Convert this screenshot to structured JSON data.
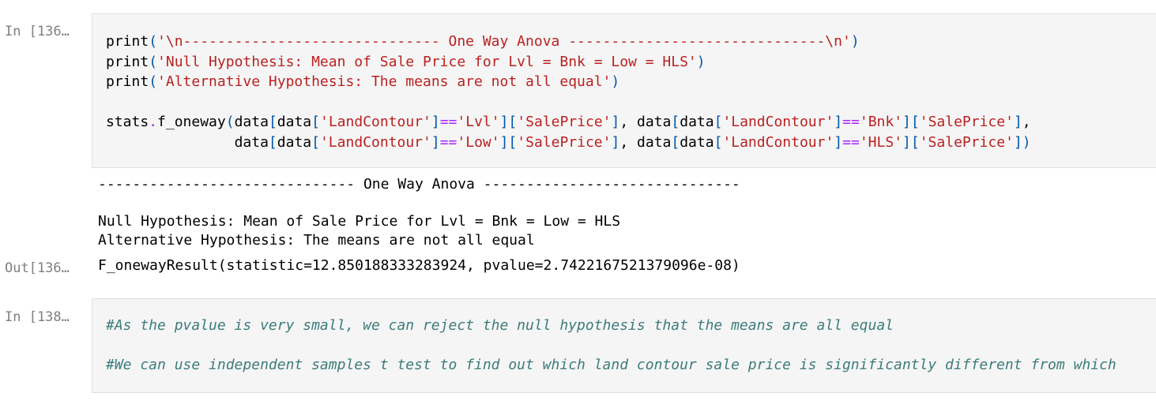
{
  "cells": {
    "cell1": {
      "prompt_in": "In [136…",
      "prompt_out": "Out[136…",
      "code": {
        "line1": {
          "fn": "print",
          "open": "(",
          "str": "'\\n------------------------------ One Way Anova ------------------------------\\n'",
          "close": ")"
        },
        "line2": {
          "fn": "print",
          "open": "(",
          "str": "'Null Hypothesis: Mean of Sale Price for Lvl = Bnk = Low = HLS'",
          "close": ")"
        },
        "line3": {
          "fn": "print",
          "open": "(",
          "str": "'Alternative Hypothesis: The means are not all equal'",
          "close": ")"
        },
        "line5": {
          "a": "stats",
          "dot": ".",
          "b": "f_oneway",
          "p1": "(",
          "c": "data",
          "p2": "[",
          "d": "data",
          "p3": "[",
          "s1": "'LandContour'",
          "p4": "]",
          "eq1": "==",
          "s2": "'Lvl'",
          "p5": "][",
          "s3": "'SalePrice'",
          "p6": "]",
          "comma1": ", ",
          "e": "data",
          "p7": "[",
          "f": "data",
          "p8": "[",
          "s4": "'LandContour'",
          "p9": "]",
          "eq2": "==",
          "s5": "'Bnk'",
          "p10": "][",
          "s6": "'SalePrice'",
          "p11": "]",
          "comma2": ","
        },
        "line6": {
          "indent": "               ",
          "c": "data",
          "p2": "[",
          "d": "data",
          "p3": "[",
          "s1": "'LandContour'",
          "p4": "]",
          "eq1": "==",
          "s2": "'Low'",
          "p5": "][",
          "s3": "'SalePrice'",
          "p6": "]",
          "comma1": ", ",
          "e": "data",
          "p7": "[",
          "f": "data",
          "p8": "[",
          "s4": "'LandContour'",
          "p9": "]",
          "eq2": "==",
          "s5": "'HLS'",
          "p10": "][",
          "s6": "'SalePrice'",
          "p11": "])"
        }
      },
      "stdout": {
        "line1": "------------------------------ One Way Anova ------------------------------",
        "line2": "Null Hypothesis: Mean of Sale Price for Lvl = Bnk = Low = HLS",
        "line3": "Alternative Hypothesis: The means are not all equal"
      },
      "result": "F_onewayResult(statistic=12.850188333283924, pvalue=2.7422167521379096e-08)"
    },
    "cell2": {
      "prompt_in": "In [138…",
      "comment1": "#As the pvalue is very small, we can reject the null hypothesis that the means are all equal",
      "comment2": "#We can use independent samples t test to find out which land contour sale price is significantly different from which"
    }
  },
  "colors": {
    "string": "#ba2121",
    "operator": "#aa22ff",
    "bracket": "#0055aa",
    "comment": "#3d7b7b",
    "prompt": "#7f7f7f",
    "cell_bg": "#f5f5f5"
  }
}
